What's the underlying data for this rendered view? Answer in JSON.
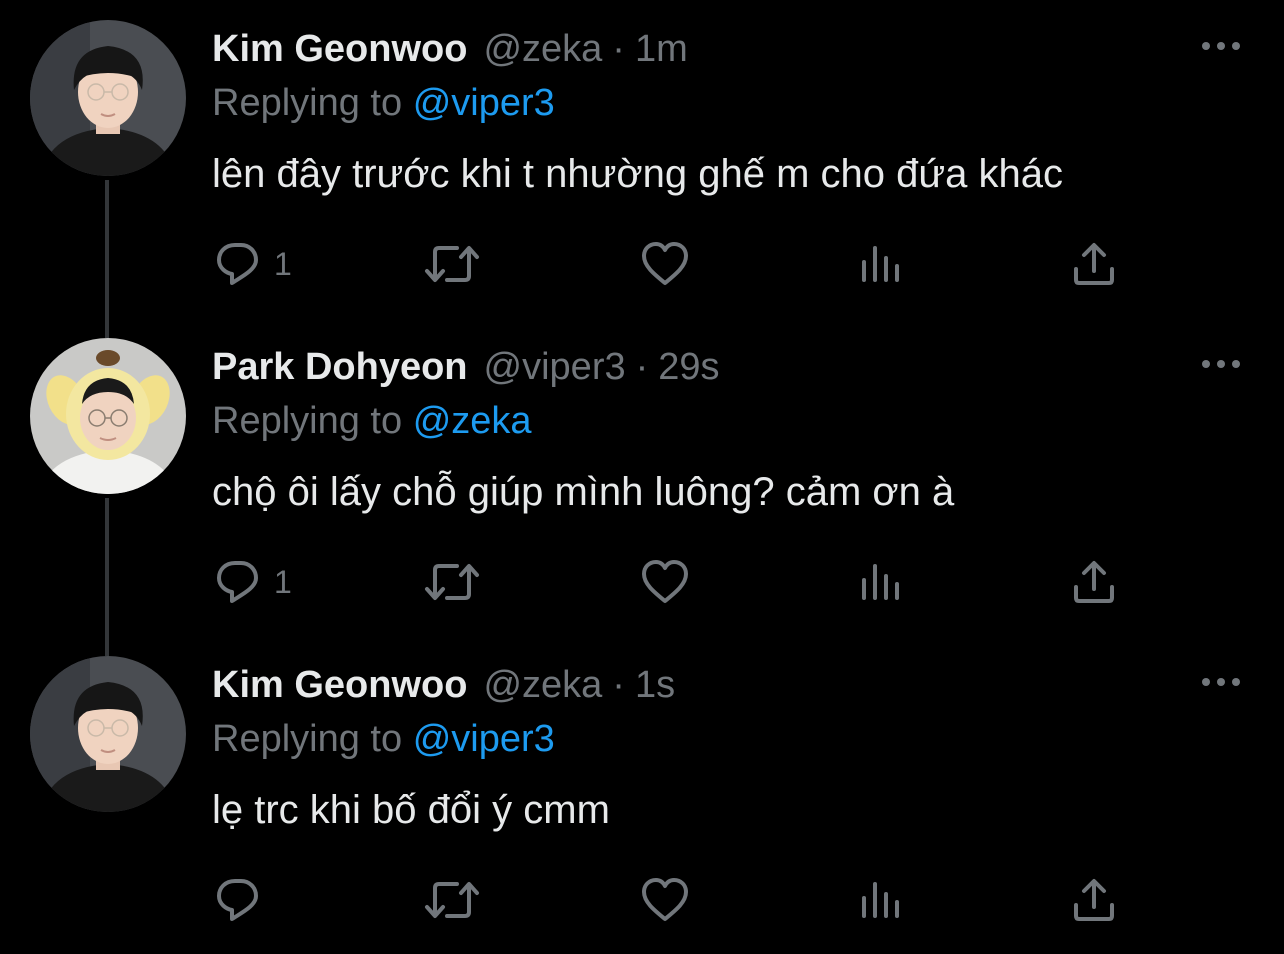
{
  "colors": {
    "background": "#000000",
    "text_primary": "#e7e9ea",
    "text_secondary": "#71767b",
    "link": "#1d9bf0",
    "thread_line": "#333639"
  },
  "tweets": [
    {
      "display_name": "Kim Geonwoo",
      "handle": "@zeka",
      "separator": "·",
      "time": "1m",
      "reply_label": "Replying to",
      "reply_to": "@viper3",
      "text": "lên đây trước khi t nhường ghế m cho đứa khác",
      "reply_count": "1",
      "avatar_icon": "profile-photo-man-dark-hair-glasses"
    },
    {
      "display_name": "Park Dohyeon",
      "handle": "@viper3",
      "separator": "·",
      "time": "29s",
      "reply_label": "Replying to",
      "reply_to": "@zeka",
      "text": "chộ ôi lấy chỗ giúp mình luông? cảm ơn à",
      "reply_count": "1",
      "avatar_icon": "profile-photo-man-yellow-dog-hood"
    },
    {
      "display_name": "Kim Geonwoo",
      "handle": "@zeka",
      "separator": "·",
      "time": "1s",
      "reply_label": "Replying to",
      "reply_to": "@viper3",
      "text": "lẹ trc khi bố đổi ý cmm",
      "reply_count": "",
      "avatar_icon": "profile-photo-man-dark-hair-glasses"
    }
  ],
  "icons": {
    "more": "more-horizontal-icon",
    "reply": "reply-bubble-icon",
    "retweet": "retweet-icon",
    "like": "heart-icon",
    "views": "views-bar-chart-icon",
    "share": "share-upload-icon"
  }
}
